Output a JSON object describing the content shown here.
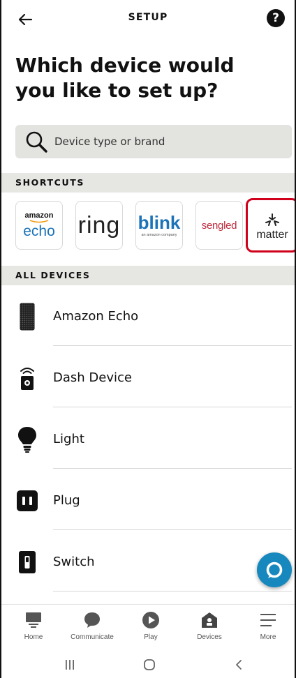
{
  "header": {
    "title": "SETUP",
    "help_label": "?"
  },
  "page": {
    "title": "Which device would you like to set up?"
  },
  "search": {
    "placeholder": "Device type or brand"
  },
  "sections": {
    "shortcuts": "SHORTCUTS",
    "all_devices": "ALL DEVICES"
  },
  "shortcuts": [
    {
      "brand": "amazon echo",
      "line1": "amazon",
      "line2": "echo"
    },
    {
      "brand": "ring",
      "line1": "ring"
    },
    {
      "brand": "blink",
      "line1": "blink",
      "line2": "an amazon company"
    },
    {
      "brand": "sengled",
      "line1": "sengled"
    },
    {
      "brand": "matter",
      "line1": "matter",
      "highlighted": true
    }
  ],
  "devices": [
    {
      "label": "Amazon Echo",
      "icon": "echo-speaker-icon"
    },
    {
      "label": "Dash Device",
      "icon": "dash-button-icon"
    },
    {
      "label": "Light",
      "icon": "light-bulb-icon"
    },
    {
      "label": "Plug",
      "icon": "smart-plug-icon"
    },
    {
      "label": "Switch",
      "icon": "light-switch-icon"
    }
  ],
  "bottom_nav": [
    {
      "label": "Home",
      "icon": "home-icon"
    },
    {
      "label": "Communicate",
      "icon": "chat-bubble-icon"
    },
    {
      "label": "Play",
      "icon": "play-icon"
    },
    {
      "label": "Devices",
      "icon": "devices-icon",
      "active": true
    },
    {
      "label": "More",
      "icon": "menu-icon"
    }
  ],
  "colors": {
    "accent": "#1788bd",
    "brand_blue": "#1b73b8",
    "highlight_red": "#d0021b",
    "section_bg": "#e6e6e3",
    "search_bg": "#e3e3e0"
  }
}
